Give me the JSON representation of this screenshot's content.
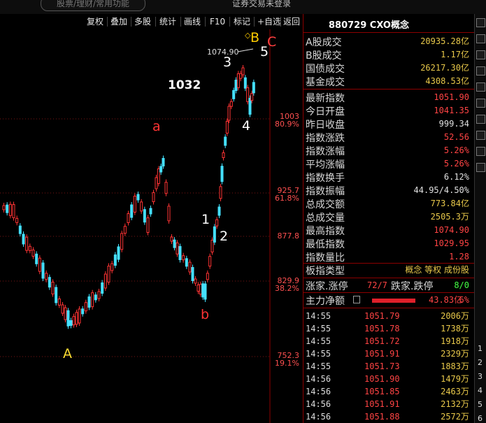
{
  "top": {
    "search_placeholder": "股票/理财/常用功能",
    "status": "证券交易未登录"
  },
  "toolbar": [
    "复权",
    "叠加",
    "多股",
    "统计",
    "画线",
    "F10",
    "标记",
    "+自选",
    "返回"
  ],
  "chart_labels": {
    "peak_price": "1074.90",
    "top_number": "1032",
    "wave_A": "A",
    "wave_a": "a",
    "wave_b": "b",
    "wave_B": "B",
    "wave_C": "C",
    "wave_1": "1",
    "wave_2": "2",
    "wave_3": "3",
    "wave_4": "4",
    "wave_5": "5",
    "diamond": "◇"
  },
  "price_levels": [
    {
      "price": "1003",
      "pct": "80.9%"
    },
    {
      "price": "925.7",
      "pct": "61.8%"
    },
    {
      "price": "877.8",
      "pct": ""
    },
    {
      "price": "829.9",
      "pct": "38.2%"
    },
    {
      "price": "752.3",
      "pct": "19.1%"
    }
  ],
  "panel": {
    "title": "880729 CXO概念",
    "group1": [
      {
        "label": "A股成交",
        "value": "20935.28亿",
        "color": "#e8c84a"
      },
      {
        "label": "B股成交",
        "value": "1.17亿",
        "color": "#e8c84a"
      },
      {
        "label": "国债成交",
        "value": "26217.30亿",
        "color": "#e8c84a"
      },
      {
        "label": "基金成交",
        "value": "4308.53亿",
        "color": "#e8c84a"
      }
    ],
    "group2": [
      {
        "label": "最新指数",
        "value": "1051.90",
        "color": "#ff4444"
      },
      {
        "label": "今日开盘",
        "value": "1041.35",
        "color": "#ff4444"
      },
      {
        "label": "昨日收盘",
        "value": "999.34",
        "color": "#e0e0e0"
      },
      {
        "label": "指数涨跌",
        "value": "52.56",
        "color": "#ff4444"
      },
      {
        "label": "指数涨幅",
        "value": "5.26%",
        "color": "#ff4444"
      },
      {
        "label": "平均涨幅",
        "value": "5.26%",
        "color": "#ff4444"
      },
      {
        "label": "指数换手",
        "value": "6.12%",
        "color": "#e0e0e0"
      },
      {
        "label": "指数振幅",
        "value": "44.95/4.50%",
        "color": "#e0e0e0"
      },
      {
        "label": "总成交额",
        "value": "773.84亿",
        "color": "#e8c84a"
      },
      {
        "label": "总成交量",
        "value": "2505.3万",
        "color": "#e8c84a"
      },
      {
        "label": "最高指数",
        "value": "1074.90",
        "color": "#ff4444"
      },
      {
        "label": "最低指数",
        "value": "1029.95",
        "color": "#ff4444"
      },
      {
        "label": "指数量比",
        "value": "1.28",
        "color": "#ff4444"
      }
    ],
    "sector": {
      "label": "板指类型",
      "value": "概念 等权 成份股"
    },
    "updown": {
      "label1": "涨家.涨停",
      "val1": "72/7",
      "label2": "跌家.跌停",
      "val2": "8/0"
    },
    "mainflow": {
      "label": "主力净额",
      "value": "43.83亿",
      "pct": "6%"
    },
    "ticks": [
      {
        "time": "14:55",
        "price": "1051.79",
        "vol": "2006万"
      },
      {
        "time": "14:55",
        "price": "1051.78",
        "vol": "1738万"
      },
      {
        "time": "14:55",
        "price": "1051.72",
        "vol": "1918万"
      },
      {
        "time": "14:55",
        "price": "1051.91",
        "vol": "2329万"
      },
      {
        "time": "14:55",
        "price": "1051.73",
        "vol": "1883万"
      },
      {
        "time": "14:56",
        "price": "1051.90",
        "vol": "1479万"
      },
      {
        "time": "14:56",
        "price": "1051.85",
        "vol": "2463万"
      },
      {
        "time": "14:56",
        "price": "1051.91",
        "vol": "2132万"
      },
      {
        "time": "14:56",
        "price": "1051.88",
        "vol": "2572万"
      }
    ]
  },
  "sidebar_numbers": [
    "1",
    "2",
    "3",
    "4",
    "5",
    "6"
  ],
  "colors": {
    "up": "#ff3333",
    "down": "#44e0ff",
    "accent": "#ffcc00",
    "border": "#8b0000"
  }
}
